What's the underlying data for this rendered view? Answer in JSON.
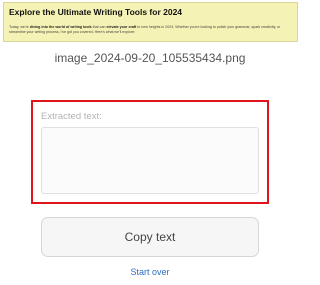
{
  "thumbnail": {
    "title": "Explore the Ultimate Writing Tools for 2024",
    "body_pre": "Today, we're ",
    "body_bold1": "diving into the world of writing tools",
    "body_mid1": " that can ",
    "body_bold2": "elevate your craft",
    "body_post": " to new heights in 2024. Whether you're looking to polish your grammar, spark creativity, or streamline your writing process, I've got you covered. Here's what we'll explore:",
    "background": "#f4f2b4"
  },
  "file_name": "image_2024-09-20_105535434.png",
  "extract": {
    "label": "Extracted text:",
    "value": "",
    "highlight_color": "#e0151b"
  },
  "actions": {
    "copy_label": "Copy text",
    "start_over_label": "Start over",
    "link_color": "#2f6fbf"
  }
}
